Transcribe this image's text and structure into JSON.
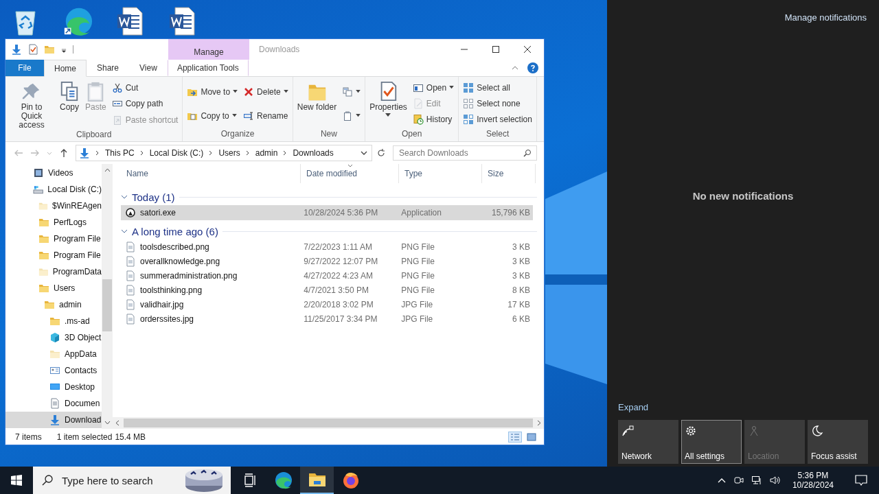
{
  "desktop_icons": [
    {
      "kind": "recycle-bin"
    },
    {
      "kind": "edge"
    },
    {
      "kind": "word-document"
    },
    {
      "kind": "word-document"
    }
  ],
  "explorer": {
    "title": "Downloads",
    "contextual_group": "Manage",
    "quick_access": [
      {
        "kind": "download"
      },
      {
        "kind": "properties"
      },
      {
        "kind": "folder"
      },
      {
        "kind": "customize"
      }
    ],
    "tabs": [
      {
        "label": "File",
        "kind": "file",
        "selected": false
      },
      {
        "label": "Home",
        "kind": "normal",
        "selected": true
      },
      {
        "label": "Share",
        "kind": "normal",
        "selected": false
      },
      {
        "label": "View",
        "kind": "normal",
        "selected": false
      },
      {
        "label": "Application Tools",
        "kind": "contextual",
        "selected": false
      }
    ],
    "ribbon_groups": [
      {
        "name": "Clipboard",
        "columns": [
          [
            {
              "label": "Pin to Quick access",
              "kind": "pin",
              "disabled": false,
              "dropdown": false
            }
          ],
          [
            {
              "label": "Copy",
              "kind": "copy",
              "disabled": false,
              "dropdown": false
            }
          ],
          [
            {
              "label": "Paste",
              "kind": "paste",
              "disabled": true,
              "dropdown": false
            }
          ],
          [
            {
              "label": "Cut",
              "kind": "cut",
              "disabled": false,
              "dropdown": false
            },
            {
              "label": "Copy path",
              "kind": "copy-path",
              "disabled": false,
              "dropdown": false
            },
            {
              "label": "Paste shortcut",
              "kind": "paste-shortcut",
              "disabled": true,
              "dropdown": false
            }
          ]
        ]
      },
      {
        "name": "Organize",
        "columns": [
          [
            {
              "label": "Move to",
              "kind": "move-to",
              "disabled": false,
              "dropdown": true
            },
            {
              "label": "Copy to",
              "kind": "copy-to",
              "disabled": false,
              "dropdown": true
            }
          ],
          [
            {
              "label": "Delete",
              "kind": "delete",
              "disabled": false,
              "dropdown": true
            },
            {
              "label": "Rename",
              "kind": "rename",
              "disabled": false,
              "dropdown": false
            }
          ]
        ]
      },
      {
        "name": "New",
        "columns": [
          [
            {
              "label": "New folder",
              "kind": "new-folder",
              "disabled": false,
              "dropdown": false
            }
          ],
          [
            {
              "kind": "new-item",
              "disabled": false,
              "dropdown": true
            },
            {
              "kind": "easy-access",
              "disabled": false,
              "dropdown": true
            }
          ]
        ]
      },
      {
        "name": "Open",
        "columns": [
          [
            {
              "label": "Properties",
              "kind": "properties",
              "disabled": false,
              "dropdown": true
            }
          ],
          [
            {
              "label": "Open",
              "kind": "open",
              "disabled": false,
              "dropdown": true
            },
            {
              "label": "Edit",
              "kind": "edit",
              "disabled": true,
              "dropdown": false
            },
            {
              "label": "History",
              "kind": "history",
              "disabled": false,
              "dropdown": false
            }
          ]
        ]
      },
      {
        "name": "Select",
        "columns": [
          [
            {
              "label": "Select all",
              "kind": "select-all",
              "disabled": false,
              "dropdown": false
            },
            {
              "label": "Select none",
              "kind": "select-none",
              "disabled": false,
              "dropdown": false
            },
            {
              "label": "Invert selection",
              "kind": "invert-selection",
              "disabled": false,
              "dropdown": false
            }
          ]
        ]
      }
    ],
    "address": {
      "path": [
        "This PC",
        "Local Disk (C:)",
        "Users",
        "admin",
        "Downloads"
      ]
    },
    "search": {
      "placeholder": "Search Downloads"
    },
    "nav_tree": [
      {
        "label": "Videos",
        "kind": "video",
        "selected": false
      },
      {
        "label": "Local Disk (C:)",
        "kind": "drive",
        "selected": false,
        "children": [
          {
            "label": "$WinREAgen",
            "kind": "hidden-folder",
            "selected": false
          },
          {
            "label": "PerfLogs",
            "kind": "folder",
            "selected": false
          },
          {
            "label": "Program File",
            "kind": "folder",
            "selected": false
          },
          {
            "label": "Program File",
            "kind": "folder",
            "selected": false
          },
          {
            "label": "ProgramData",
            "kind": "hidden-folder",
            "selected": false
          },
          {
            "label": "Users",
            "kind": "folder",
            "selected": false,
            "children": [
              {
                "label": "admin",
                "kind": "folder",
                "selected": false,
                "children": [
                  {
                    "label": ".ms-ad",
                    "kind": "folder",
                    "selected": false
                  },
                  {
                    "label": "3D Object",
                    "kind": "cube",
                    "selected": false
                  },
                  {
                    "label": "AppData",
                    "kind": "hidden-folder",
                    "selected": false
                  },
                  {
                    "label": "Contacts",
                    "kind": "contacts",
                    "selected": false
                  },
                  {
                    "label": "Desktop",
                    "kind": "desktop",
                    "selected": false
                  },
                  {
                    "label": "Documen",
                    "kind": "documents",
                    "selected": false
                  },
                  {
                    "label": "Download",
                    "kind": "download",
                    "selected": true
                  }
                ]
              }
            ]
          }
        ]
      }
    ],
    "columns": [
      "Name",
      "Date modified",
      "Type",
      "Size"
    ],
    "groups": [
      {
        "label": "Today (1)",
        "files": [
          {
            "name": "satori.exe",
            "date": "10/28/2024 5:36 PM",
            "type": "Application",
            "size": "15,796 KB",
            "kind": "application",
            "selected": true
          }
        ]
      },
      {
        "label": "A long time ago (6)",
        "files": [
          {
            "name": "toolsdescribed.png",
            "date": "7/22/2023 1:11 AM",
            "type": "PNG File",
            "size": "3 KB",
            "kind": "image",
            "selected": false
          },
          {
            "name": "overallknowledge.png",
            "date": "9/27/2022 12:07 PM",
            "type": "PNG File",
            "size": "3 KB",
            "kind": "image",
            "selected": false
          },
          {
            "name": "summeradministration.png",
            "date": "4/27/2022 4:23 AM",
            "type": "PNG File",
            "size": "3 KB",
            "kind": "image",
            "selected": false
          },
          {
            "name": "toolsthinking.png",
            "date": "4/7/2021 3:50 PM",
            "type": "PNG File",
            "size": "8 KB",
            "kind": "image",
            "selected": false
          },
          {
            "name": "validhair.jpg",
            "date": "2/20/2018 3:02 PM",
            "type": "JPG File",
            "size": "17 KB",
            "kind": "image",
            "selected": false
          },
          {
            "name": "orderssites.jpg",
            "date": "11/25/2017 3:34 PM",
            "type": "JPG File",
            "size": "6 KB",
            "kind": "image",
            "selected": false
          }
        ]
      }
    ],
    "status": {
      "count": "7 items",
      "selection": "1 item selected",
      "size": "15.4 MB"
    },
    "views": [
      {
        "kind": "details",
        "selected": true
      },
      {
        "kind": "large-icons",
        "selected": false
      }
    ]
  },
  "action_center": {
    "manage": "Manage notifications",
    "empty": "No new notifications",
    "expand": "Expand",
    "tiles": [
      {
        "label": "Network",
        "kind": "network",
        "highlighted": false,
        "disabled": false
      },
      {
        "label": "All settings",
        "kind": "settings",
        "highlighted": true,
        "disabled": false
      },
      {
        "label": "Location",
        "kind": "location",
        "highlighted": false,
        "disabled": true
      },
      {
        "label": "Focus assist",
        "kind": "focus-assist",
        "highlighted": false,
        "disabled": false
      }
    ]
  },
  "taskbar": {
    "search": {
      "placeholder": "Type here to search"
    },
    "apps": [
      {
        "kind": "task-view",
        "active": false
      },
      {
        "kind": "edge",
        "active": false
      },
      {
        "kind": "file-explorer",
        "active": true
      },
      {
        "kind": "firefox",
        "active": false
      }
    ],
    "tray": [
      {
        "kind": "chevron"
      },
      {
        "kind": "meet"
      },
      {
        "kind": "network"
      },
      {
        "kind": "volume"
      }
    ],
    "time": "5:36 PM",
    "date": "10/28/2024"
  }
}
